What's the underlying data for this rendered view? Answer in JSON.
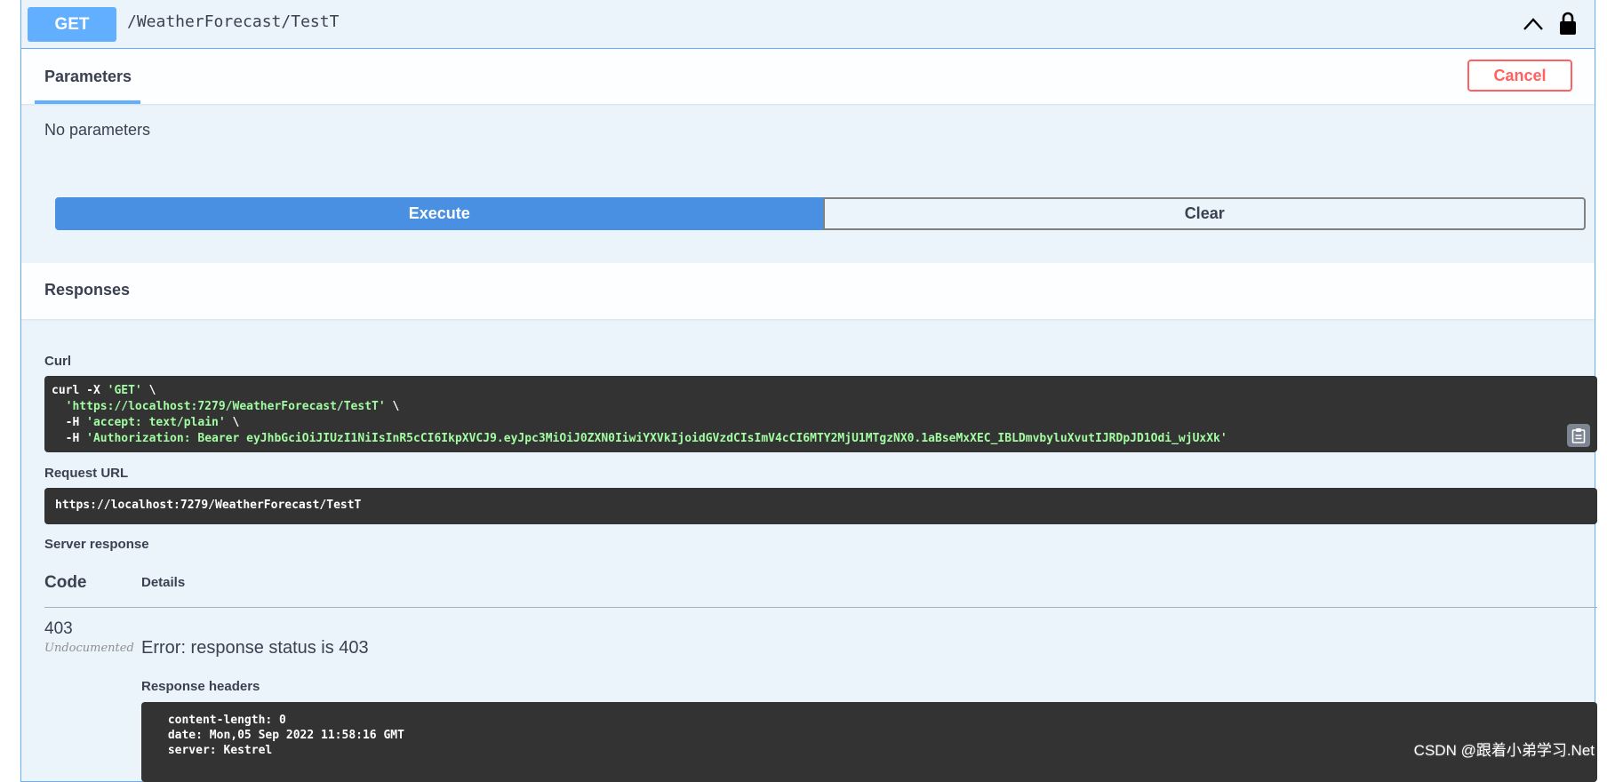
{
  "operation": {
    "method": "GET",
    "path": "/WeatherForecast/TestT"
  },
  "parameters": {
    "tab_label": "Parameters",
    "cancel_label": "Cancel",
    "empty_text": "No parameters"
  },
  "actions": {
    "execute_label": "Execute",
    "clear_label": "Clear"
  },
  "responses": {
    "title": "Responses",
    "curl_label": "Curl",
    "curl": {
      "line1_cmd": "curl -X ",
      "line1_method": "'GET'",
      "line1_end": " \\",
      "line2_url": "  'https://localhost:7279/WeatherForecast/TestT'",
      "line2_end": " \\",
      "line3_flag": "  -H ",
      "line3_value": "'accept: text/plain'",
      "line3_end": " \\",
      "line4_flag": "  -H ",
      "line4_value": "'Authorization: Bearer eyJhbGciOiJIUzI1NiIsInR5cCI6IkpXVCJ9.eyJpc3MiOiJ0ZXN0IiwiYXVkIjoidGVzdCIsImV4cCI6MTY2MjU1MTgzNX0.1aBseMxXEC_IBLDmvbyluXvutIJRDpJD1Odi_wjUxXk'"
    },
    "request_url_label": "Request URL",
    "request_url": "https://localhost:7279/WeatherForecast/TestT",
    "server_response_label": "Server response",
    "col_code": "Code",
    "col_details": "Details",
    "status_code": "403",
    "undocumented": "Undocumented",
    "error_message": "Error: response status is 403",
    "response_headers_label": "Response headers",
    "response_headers": " content-length: 0 \n date: Mon,05 Sep 2022 11:58:16 GMT \n server: Kestrel "
  },
  "watermark": "CSDN @跟着小弟学习.Net",
  "icons": {
    "collapse": "chevron-up-icon",
    "authorize": "lock-icon",
    "copy": "clipboard-icon"
  },
  "colors": {
    "get_accent": "#61affe",
    "execute": "#4990e2",
    "cancel": "#ff6060",
    "code_bg": "#333333",
    "code_string": "#a2fca2"
  }
}
